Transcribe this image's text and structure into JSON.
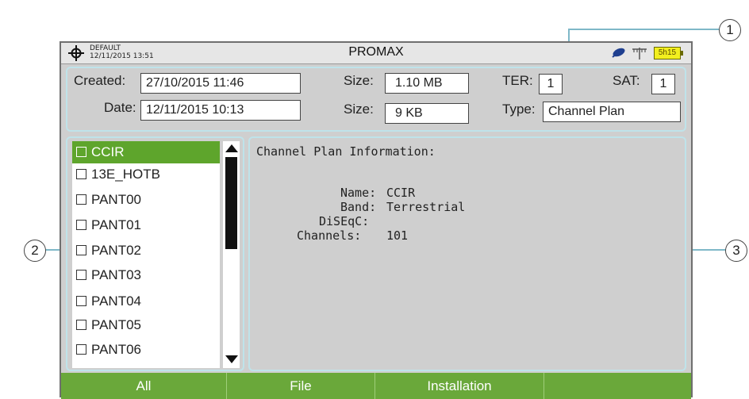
{
  "header": {
    "profile": "DEFAULT",
    "datetime": "12/11/2015 13:51",
    "title": "PROMAX",
    "battery": "5h15"
  },
  "info": {
    "created_label": "Created:",
    "created_value": "27/10/2015 11:46",
    "date_label": "Date:",
    "date_value": "12/11/2015 10:13",
    "size1_label": "Size:",
    "size1_value": "1.10 MB",
    "size2_label": "Size:",
    "size2_value": "9 KB",
    "ter_label": "TER:",
    "ter_value": "1",
    "sat_label": "SAT:",
    "sat_value": "1",
    "type_label": "Type:",
    "type_value": "Channel Plan"
  },
  "files": [
    {
      "label": "CCIR"
    },
    {
      "label": "13E_HOTB"
    },
    {
      "label": "PANT00"
    },
    {
      "label": "PANT01"
    },
    {
      "label": "PANT02"
    },
    {
      "label": "PANT03"
    },
    {
      "label": "PANT04"
    },
    {
      "label": "PANT05"
    },
    {
      "label": "PANT06"
    }
  ],
  "details": {
    "heading": "Channel Plan Information:",
    "name_label": "Name:",
    "name_value": "CCIR",
    "band_label": "Band:",
    "band_value": "Terrestrial",
    "diseqc_label": "DiSEqC:",
    "diseqc_value": "",
    "channels_label": "Channels:",
    "channels_value": "101"
  },
  "softkeys": [
    {
      "label": "All"
    },
    {
      "label": "File"
    },
    {
      "label": "Installation"
    },
    {
      "label": ""
    }
  ],
  "callouts": {
    "c1": "1",
    "c2": "2",
    "c3": "3"
  },
  "colors": {
    "accent_green": "#6aa83a",
    "selected_green": "#5ea52c",
    "battery_yellow": "#f2ef1f",
    "panel_outline": "#bfe3ea"
  }
}
